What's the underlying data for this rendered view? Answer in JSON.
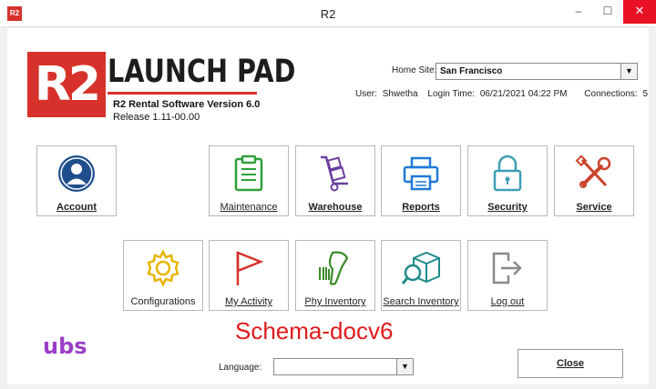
{
  "window": {
    "title": "R2",
    "app_icon_text": "R2",
    "minimize": "–",
    "maximize": "☐",
    "close": "✕"
  },
  "logo": {
    "r2": "R2",
    "title": "LAUNCH PAD"
  },
  "version": "R2 Rental Software Version 6.0",
  "release": "Release 1.11-00.00",
  "home_site": {
    "label": "Home Site:",
    "value": "San Francisco"
  },
  "session": {
    "user_label": "User:",
    "user": "Shwetha",
    "login_label": "Login Time:",
    "login_time": "06/21/2021 04:22 PM",
    "connections_label": "Connections:",
    "connections": "5"
  },
  "tiles": {
    "account": "Account",
    "maintenance": "Maintenance",
    "warehouse": "Warehouse",
    "reports": "Reports",
    "security": "Security",
    "service": "Service",
    "configurations": "Configurations",
    "my_activity": "My Activity",
    "phy_inventory": "Phy Inventory",
    "search_inventory": "Search Inventory",
    "log_out": "Log out"
  },
  "icons": {
    "account": "user-avatar-icon",
    "maintenance": "clipboard-icon",
    "warehouse": "hand-truck-icon",
    "reports": "printer-icon",
    "security": "padlock-icon",
    "service": "wrench-screwdriver-icon",
    "configurations": "gear-icon",
    "my_activity": "flag-icon",
    "phy_inventory": "barcode-scanner-icon",
    "search_inventory": "box-search-icon",
    "log_out": "logout-icon"
  },
  "colors": {
    "brand_red": "#d6322b",
    "ubs_purple": "#9b3fc8",
    "watermark_red": "#e01b1b"
  },
  "ubs_logo": "ubs",
  "watermark": "Schema-docv6",
  "language": {
    "label": "Language:",
    "value": ""
  },
  "close_button": "Close"
}
